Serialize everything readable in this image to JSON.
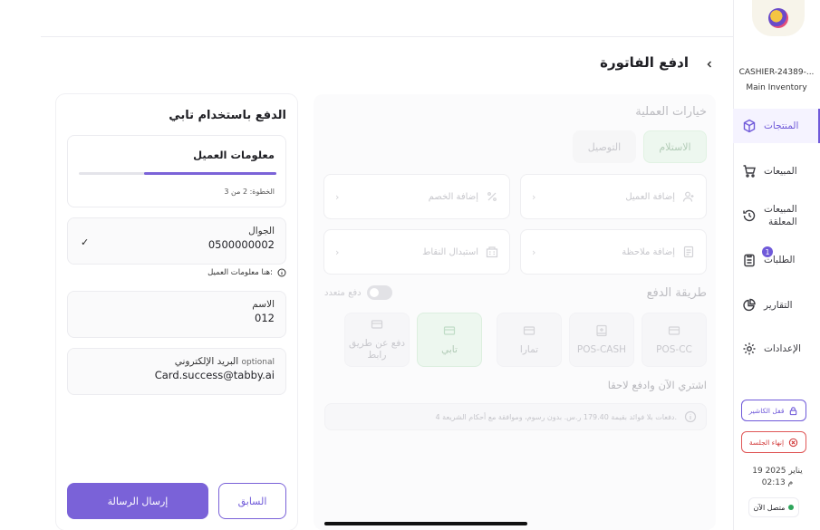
{
  "sidebar": {
    "cashier_id": "CASHIER-24389-...",
    "inventory": "Main Inventory",
    "items": [
      {
        "label": "المنتجات"
      },
      {
        "label": "المبيعات"
      },
      {
        "label_line1": "المبيعات",
        "label_line2": "المعلقة"
      },
      {
        "label": "الطلبات",
        "badge": "1"
      },
      {
        "label": "التقارير"
      },
      {
        "label": "الإعدادات"
      }
    ],
    "lock_cashier": "قفل الكاشير",
    "end_session": "إنهاء الجلسة",
    "date": "19 يناير 2025",
    "time": "02:13 م",
    "online": "متصل الآن",
    "accent_color": "#6f59d9"
  },
  "header": {
    "title": "ادفع الفاتورة"
  },
  "options": {
    "title": "خيارات العملية",
    "pickup": "الاستلام",
    "delivery": "التوصيل",
    "add_customer": "إضافة العميل",
    "add_discount": "إضافة الخصم",
    "add_note": "إضافة ملاحظة",
    "redeem_points": "استبدال النقاط",
    "payment_title": "طريقة الدفع",
    "multi_payment": "دفع متعدد",
    "methods": [
      "POS-CC",
      "POS-CASH",
      "تمارا",
      "تابي",
      "دفع عن طريق رابط"
    ],
    "selected_method": "تابي",
    "bnpl_title": "اشتري الآن وادفع لاحقا",
    "bnpl_note": "4 دفعات بلا فوائد بقيمة 179.40 ر.س. بدون رسوم، وموافقة مع أحكام الشريعة."
  },
  "tabby": {
    "title": "الدفع باستخدام تابي",
    "step_title": "معلومات العميل",
    "step_text": "الخطوة: 2 من 3",
    "progress": 0.67,
    "phone_label": "الجوال",
    "phone_value": "0500000002",
    "info_text": "هنا معلومات العميل:",
    "name_label": "الاسم",
    "name_value": "012",
    "email_label": "البريد الإلكتروني",
    "email_optional": "optional",
    "email_value": "Card.success@tabby.ai",
    "send_button": "إرسال الرسالة",
    "prev_button": "السابق"
  }
}
